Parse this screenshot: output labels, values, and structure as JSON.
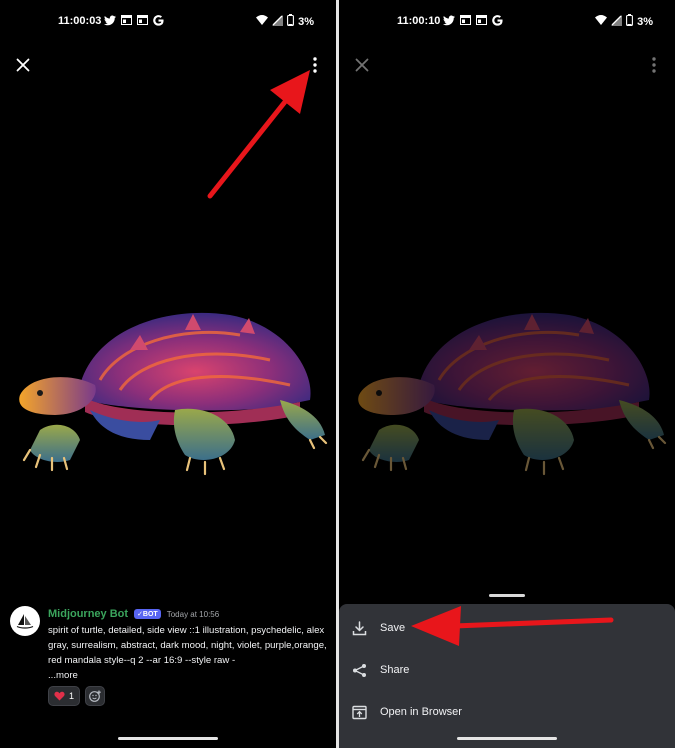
{
  "colors": {
    "background": "#000000",
    "author": "#3ba55d",
    "bot_badge": "#5865f2",
    "sheet": "#313338",
    "annotation_arrow": "#e8161b"
  },
  "left_screen": {
    "status_bar": {
      "time": "11:00:03",
      "battery": "3%"
    },
    "icons": {
      "close": "close-icon",
      "more": "more-vertical-icon"
    },
    "message": {
      "author": "Midjourney Bot",
      "badge": "✓BOT",
      "timestamp": "Today at 10:56",
      "text": "spirit of turtle, detailed, side view ::1 illustration, psychedelic, alex gray, surrealism, abstract, dark mood, night, violet, purple,orange, red mandala style--q 2 --ar 16:9 --style raw -",
      "more": "...more",
      "reactions": [
        {
          "emoji": "heart-icon",
          "count": "1"
        },
        {
          "emoji": "add-reaction-icon"
        }
      ]
    }
  },
  "right_screen": {
    "status_bar": {
      "time": "11:00:10",
      "battery": "3%"
    },
    "menu": {
      "items": [
        {
          "label": "Save",
          "icon": "download-icon"
        },
        {
          "label": "Share",
          "icon": "share-icon"
        },
        {
          "label": "Open in Browser",
          "icon": "open-external-icon"
        }
      ]
    }
  }
}
